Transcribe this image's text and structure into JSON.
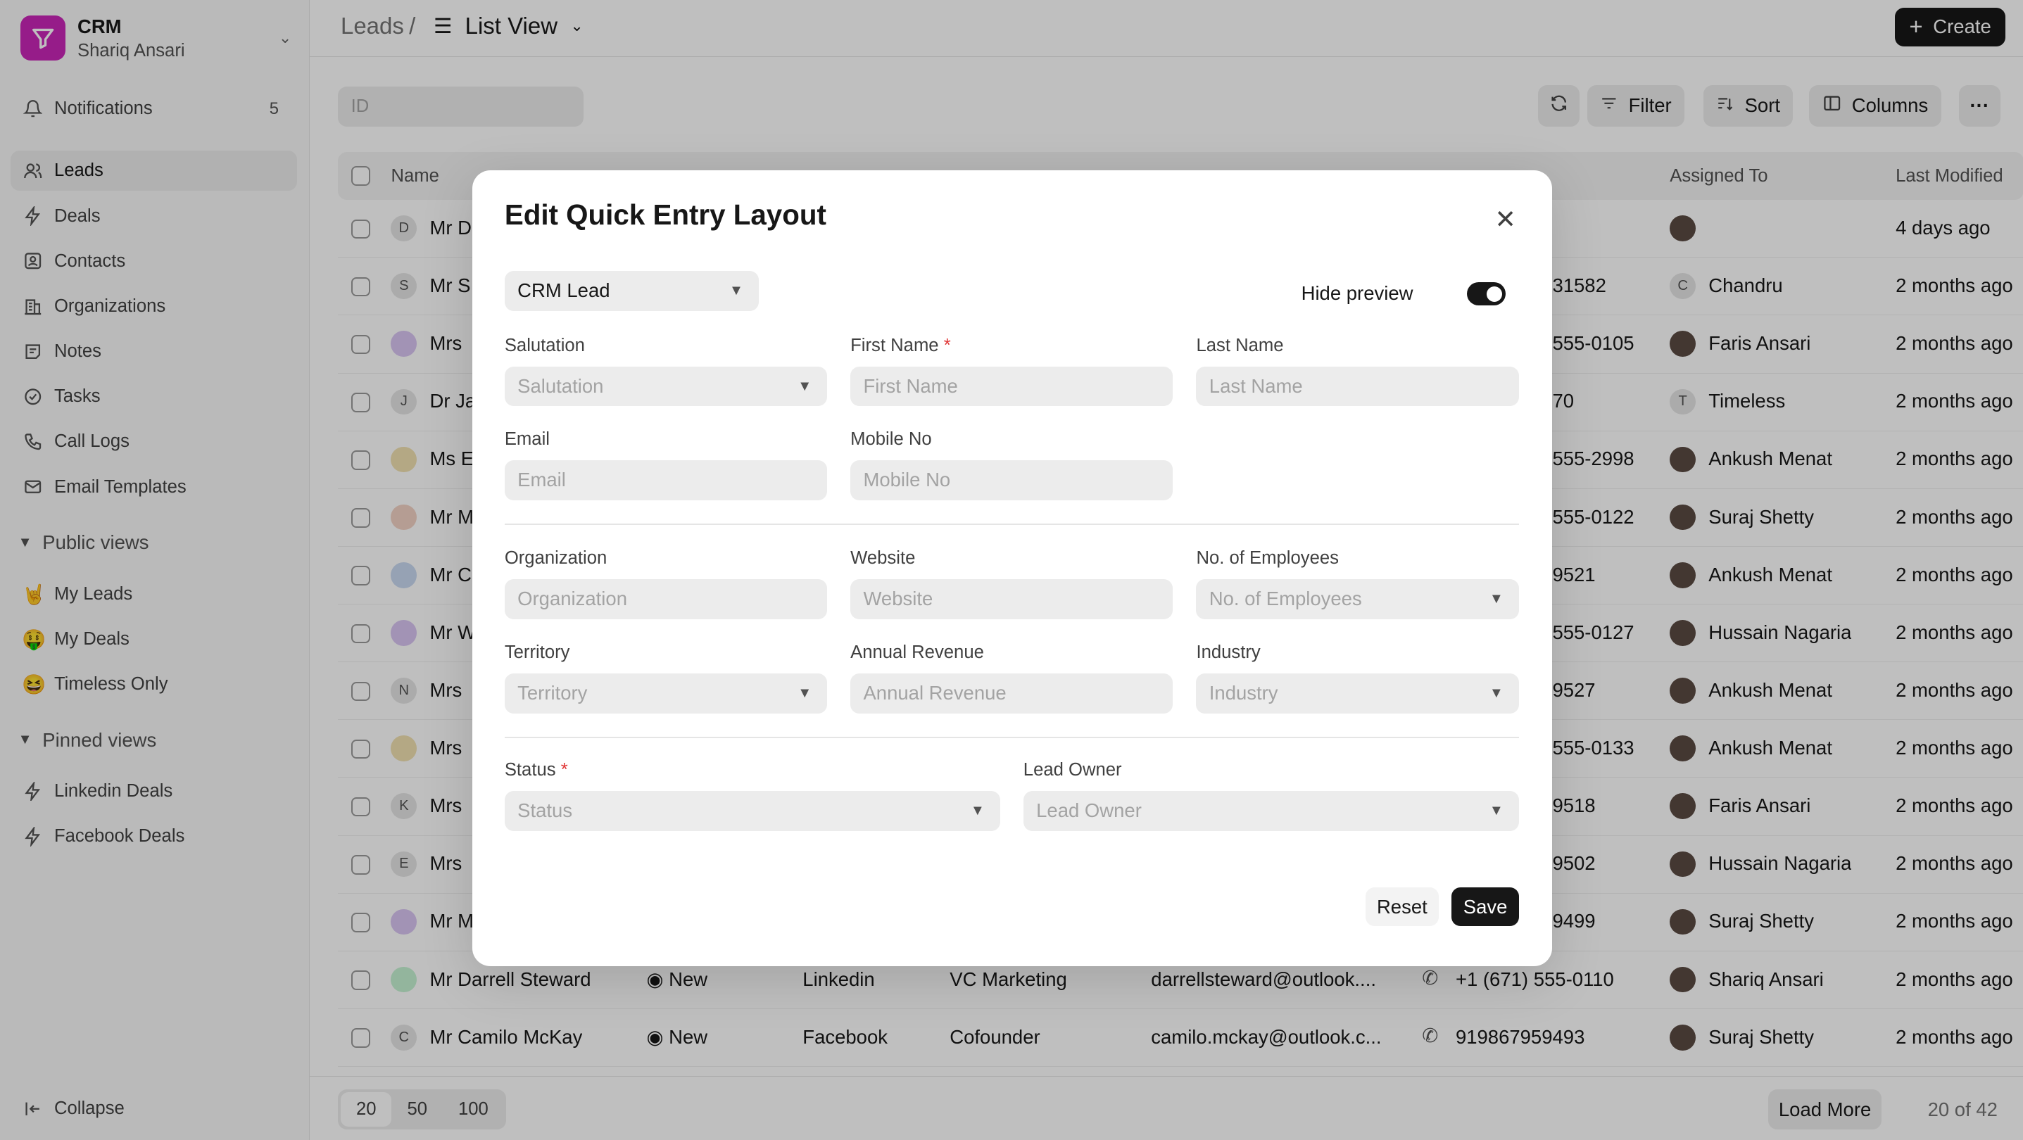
{
  "sidebar": {
    "app_name": "CRM",
    "user_name": "Shariq Ansari",
    "notifications": {
      "label": "Notifications",
      "count": "5"
    },
    "nav": [
      {
        "label": "Leads",
        "icon": "users-icon"
      },
      {
        "label": "Deals",
        "icon": "bolt-icon"
      },
      {
        "label": "Contacts",
        "icon": "contact-icon"
      },
      {
        "label": "Organizations",
        "icon": "building-icon"
      },
      {
        "label": "Notes",
        "icon": "note-icon"
      },
      {
        "label": "Tasks",
        "icon": "check-circle-icon"
      },
      {
        "label": "Call Logs",
        "icon": "phone-icon"
      },
      {
        "label": "Email Templates",
        "icon": "mail-icon"
      }
    ],
    "public_views_label": "Public views",
    "public_views": [
      {
        "label": "My Leads",
        "emoji": "🤘"
      },
      {
        "label": "My Deals",
        "emoji": "🤑"
      },
      {
        "label": "Timeless Only",
        "emoji": "😆"
      }
    ],
    "pinned_views_label": "Pinned views",
    "pinned_views": [
      {
        "label": "Linkedin Deals"
      },
      {
        "label": "Facebook Deals"
      }
    ],
    "collapse_label": "Collapse"
  },
  "header": {
    "breadcrumb_root": "Leads",
    "separator": "/",
    "view_label": "List View",
    "create_label": "Create"
  },
  "toolbar": {
    "search_placeholder": "ID",
    "filter_label": "Filter",
    "sort_label": "Sort",
    "columns_label": "Columns"
  },
  "table": {
    "columns": [
      "Name",
      "Assigned To",
      "Last Modified"
    ],
    "rows": [
      {
        "initial": "D",
        "name": "Mr D",
        "mobile": "",
        "assigned": "",
        "modified": "4 days ago"
      },
      {
        "initial": "S",
        "name": "Mr S",
        "mobile": "31582",
        "assigned": "Chandru",
        "modified": "2 months ago"
      },
      {
        "initial": "",
        "name": "Mrs",
        "mobile": "555-0105",
        "assigned": "Faris Ansari",
        "modified": "2 months ago"
      },
      {
        "initial": "J",
        "name": "Dr Ja",
        "mobile": "70",
        "assigned": "Timeless",
        "modified": "2 months ago"
      },
      {
        "initial": "",
        "name": "Ms E",
        "mobile": "555-2998",
        "assigned": "Ankush Menat",
        "modified": "2 months ago"
      },
      {
        "initial": "",
        "name": "Mr M",
        "mobile": "555-0122",
        "assigned": "Suraj Shetty",
        "modified": "2 months ago"
      },
      {
        "initial": "",
        "name": "Mr C",
        "mobile": "9521",
        "assigned": "Ankush Menat",
        "modified": "2 months ago"
      },
      {
        "initial": "",
        "name": "Mr W",
        "mobile": "555-0127",
        "assigned": "Hussain Nagaria",
        "modified": "2 months ago"
      },
      {
        "initial": "N",
        "name": "Mrs",
        "mobile": "9527",
        "assigned": "Ankush Menat",
        "modified": "2 months ago"
      },
      {
        "initial": "",
        "name": "Mrs",
        "mobile": "555-0133",
        "assigned": "Ankush Menat",
        "modified": "2 months ago"
      },
      {
        "initial": "K",
        "name": "Mrs",
        "mobile": "9518",
        "assigned": "Faris Ansari",
        "modified": "2 months ago"
      },
      {
        "initial": "E",
        "name": "Mrs",
        "mobile": "9502",
        "assigned": "Hussain Nagaria",
        "modified": "2 months ago"
      },
      {
        "initial": "",
        "name": "Mr M",
        "mobile": "9499",
        "assigned": "Suraj Shetty",
        "modified": "2 months ago"
      },
      {
        "initial": "",
        "name": "Mr Darrell Steward",
        "status": "New",
        "source": "Linkedin",
        "title": "VC Marketing",
        "email": "darrellsteward@outlook....",
        "mobile": "+1 (671) 555-0110",
        "assigned": "Shariq Ansari",
        "modified": "2 months ago"
      },
      {
        "initial": "C",
        "name": "Mr Camilo McKay",
        "status": "New",
        "source": "Facebook",
        "title": "Cofounder",
        "email": "camilo.mckay@outlook.c...",
        "mobile": "919867959493",
        "assigned": "Suraj Shetty",
        "modified": "2 months ago"
      }
    ]
  },
  "footer": {
    "page_sizes": [
      "20",
      "50",
      "100"
    ],
    "load_more": "Load More",
    "count": "20 of 42"
  },
  "modal": {
    "title": "Edit Quick Entry Layout",
    "layout_select": "CRM Lead",
    "hide_preview_label": "Hide preview",
    "hide_preview_on": true,
    "fields": {
      "salutation": {
        "label": "Salutation",
        "placeholder": "Salutation"
      },
      "first_name": {
        "label": "First Name",
        "placeholder": "First Name"
      },
      "last_name": {
        "label": "Last Name",
        "placeholder": "Last Name"
      },
      "email": {
        "label": "Email",
        "placeholder": "Email"
      },
      "mobile_no": {
        "label": "Mobile No",
        "placeholder": "Mobile No"
      },
      "organization": {
        "label": "Organization",
        "placeholder": "Organization"
      },
      "website": {
        "label": "Website",
        "placeholder": "Website"
      },
      "employees": {
        "label": "No. of Employees",
        "placeholder": "No. of Employees"
      },
      "territory": {
        "label": "Territory",
        "placeholder": "Territory"
      },
      "annual_revenue": {
        "label": "Annual Revenue",
        "placeholder": "Annual Revenue"
      },
      "industry": {
        "label": "Industry",
        "placeholder": "Industry"
      },
      "status": {
        "label": "Status",
        "placeholder": "Status"
      },
      "lead_owner": {
        "label": "Lead Owner",
        "placeholder": "Lead Owner"
      }
    },
    "required_mark": "*",
    "reset_label": "Reset",
    "save_label": "Save"
  }
}
